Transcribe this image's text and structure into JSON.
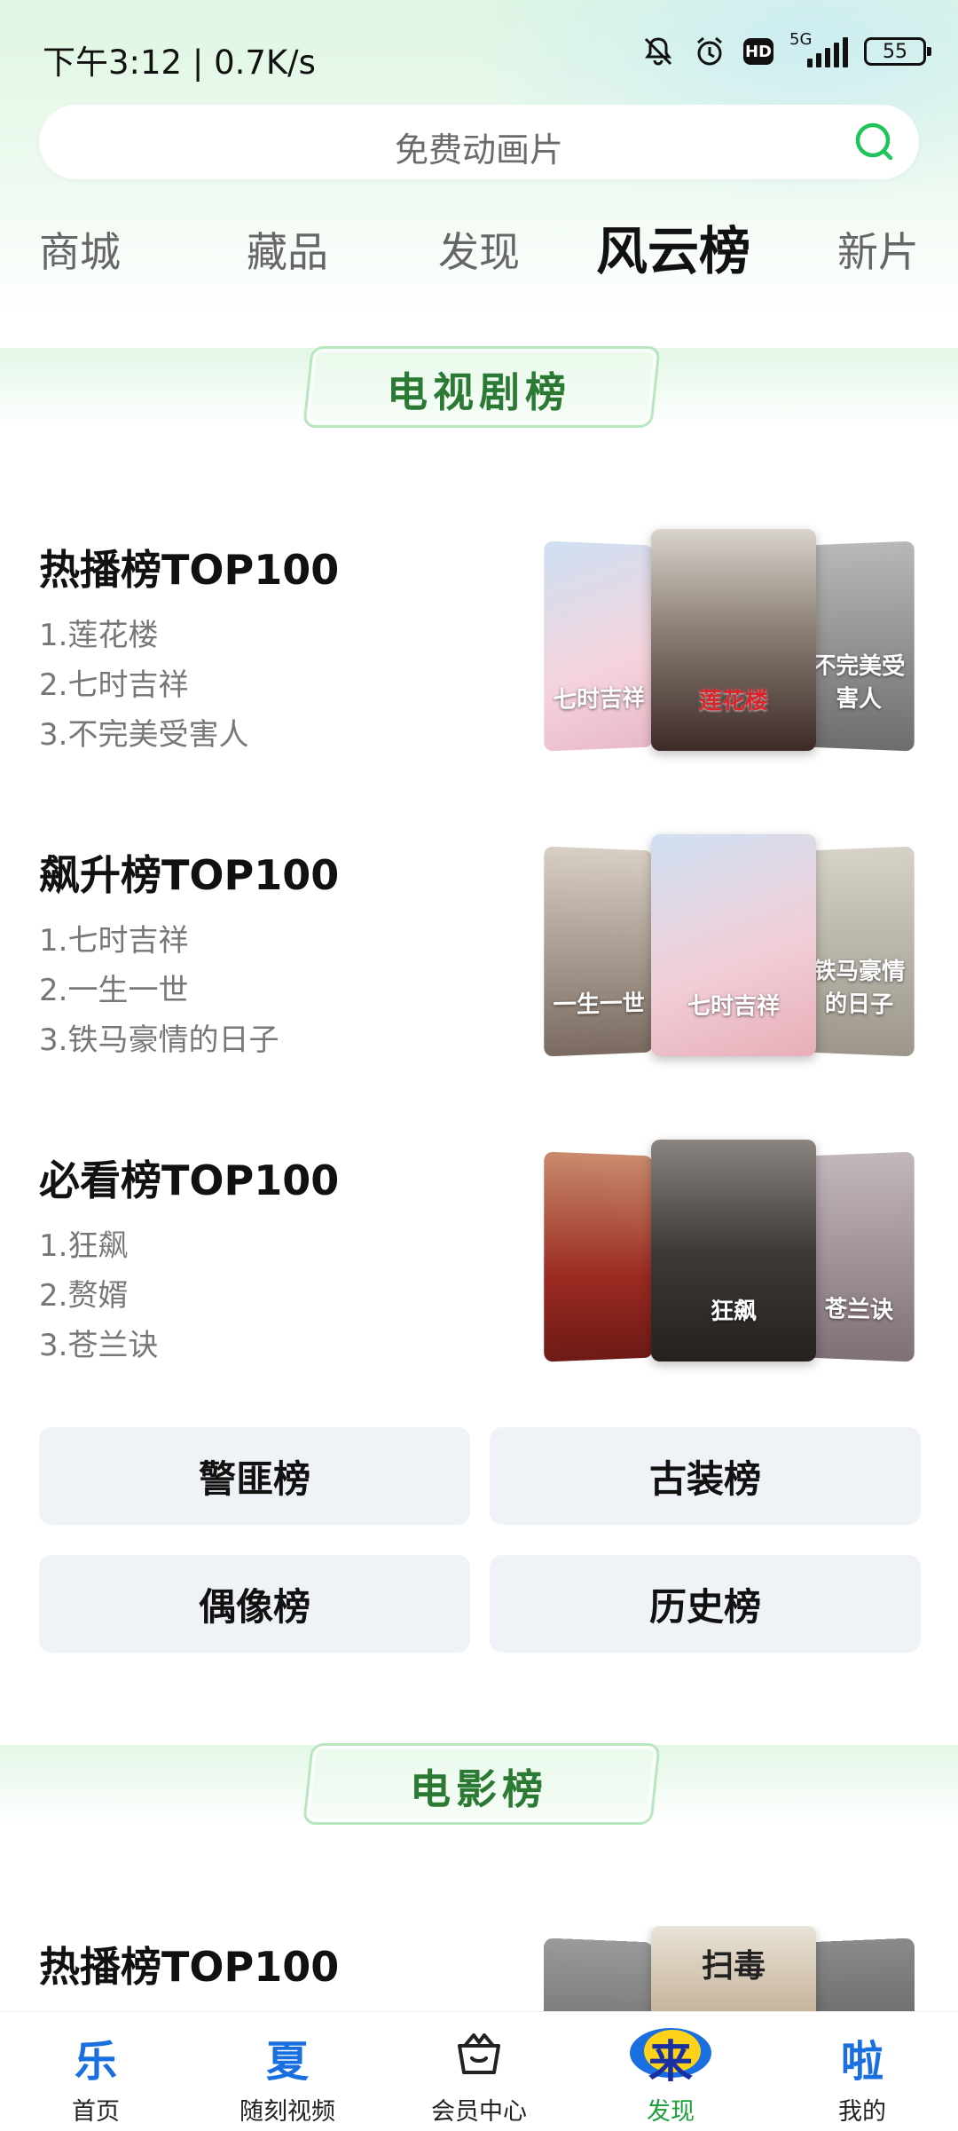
{
  "status": {
    "time": "下午3:12 | 0.7K/s",
    "network": "5G",
    "hd": "HD",
    "battery": "55"
  },
  "search": {
    "placeholder": "免费动画片"
  },
  "tabs": [
    {
      "label": "商城"
    },
    {
      "label": "藏品"
    },
    {
      "label": "发现"
    },
    {
      "label": "风云榜"
    },
    {
      "label": "新片"
    }
  ],
  "tv_section": {
    "title": "电视剧榜",
    "rankings": [
      {
        "title": "热播榜TOP100",
        "items": [
          "1.莲花楼",
          "2.七时吉祥",
          "3.不完美受害人"
        ],
        "posters": [
          {
            "caption": "七时吉祥"
          },
          {
            "caption": "莲花楼"
          },
          {
            "caption": "不完美受害人"
          }
        ]
      },
      {
        "title": "飙升榜TOP100",
        "items": [
          "1.七时吉祥",
          "2.一生一世",
          "3.铁马豪情的日子"
        ],
        "posters": [
          {
            "caption": "一生一世"
          },
          {
            "caption": "七时吉祥"
          },
          {
            "caption": "铁马豪情的日子"
          }
        ]
      },
      {
        "title": "必看榜TOP100",
        "items": [
          "1.狂飙",
          "2.赘婿",
          "3.苍兰诀"
        ],
        "posters": [
          {
            "caption": ""
          },
          {
            "caption": "狂飙"
          },
          {
            "caption": "苍兰诀"
          }
        ]
      }
    ],
    "categories": [
      "警匪榜",
      "古装榜",
      "偶像榜",
      "历史榜"
    ]
  },
  "movie_section": {
    "title": "电影榜",
    "rankings": [
      {
        "title": "热播榜TOP100",
        "posters": [
          {
            "caption": ""
          },
          {
            "caption": "扫毒"
          },
          {
            "caption": ""
          }
        ]
      }
    ]
  },
  "bottom_nav": [
    {
      "glyph": "乐",
      "label": "首页"
    },
    {
      "glyph": "夏",
      "label": "随刻视频"
    },
    {
      "glyph": "",
      "label": "会员中心"
    },
    {
      "glyph": "来",
      "label": "发现"
    },
    {
      "glyph": "啦",
      "label": "我的"
    }
  ],
  "colors": {
    "accent_green": "#1f9e3a",
    "section_title": "#2a7a34",
    "nav_blue": "#1a6fe0"
  }
}
